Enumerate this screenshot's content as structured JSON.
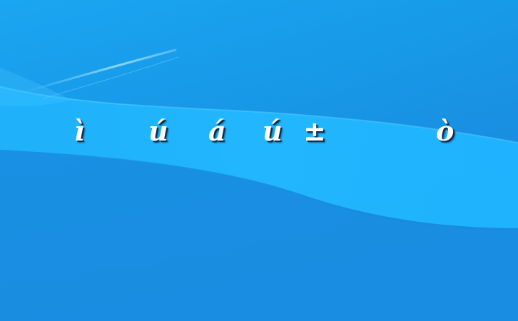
{
  "desktop": {
    "wallpaper": {
      "style": "blue-wave",
      "colors": {
        "base": "#1a8fe2",
        "light": "#1fb6ff",
        "highlight": "#7fdcff"
      }
    },
    "glyphs": [
      "ì",
      "ú",
      "á",
      "ú",
      "±",
      "ò"
    ]
  }
}
